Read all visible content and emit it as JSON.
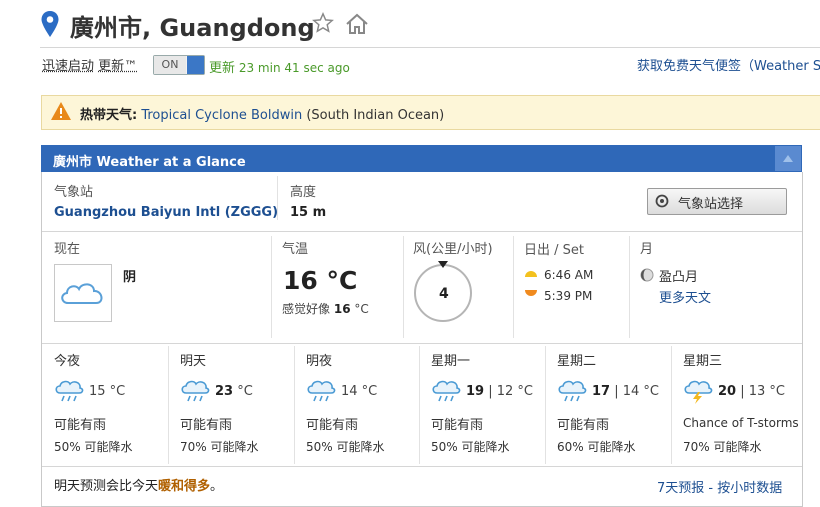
{
  "header": {
    "title": "廣州市, Guangdong"
  },
  "toolbar": {
    "quick_start": "迅速启动",
    "update": "更新™",
    "toggle_label": "ON",
    "updated_prefix": "更新",
    "updated_time": "23 min 41 sec ago",
    "widget_link": "获取免费天气便签（Weather S"
  },
  "alert": {
    "label": "热带天气:",
    "link": "Tropical Cyclone Boldwin",
    "region": "(South Indian Ocean)"
  },
  "glance": {
    "title": "廣州市 Weather at a Glance",
    "station_label": "气象站",
    "station_value": "Guangzhou Baiyun Intl (ZGGG)",
    "elevation_label": "高度",
    "elevation_value": "15 m",
    "station_button": "气象站选择",
    "now_label": "现在",
    "condition": "阴",
    "temp_label": "气温",
    "temp_value": "16 °C",
    "feels_label": "感觉好像",
    "feels_value": "16",
    "feels_unit": "°C",
    "wind_label": "风(公里/小时)",
    "wind_value": "4",
    "sun_label": "日出 / Set",
    "sunrise": "6:46 AM",
    "sunset": "5:39 PM",
    "moon_label": "月",
    "moon_phase": "盈凸月",
    "more_astro": "更多天文"
  },
  "forecast": [
    {
      "name": "今夜",
      "hi": "",
      "lo": "15 °C",
      "cond": "可能有雨",
      "pop": "50% 可能降水",
      "icon": "rain-cloud-icon"
    },
    {
      "name": "明天",
      "hi": "23",
      "lo": "°C",
      "cond": "可能有雨",
      "pop": "70% 可能降水",
      "icon": "rain-cloud-icon"
    },
    {
      "name": "明夜",
      "hi": "",
      "lo": "14 °C",
      "cond": "可能有雨",
      "pop": "50% 可能降水",
      "icon": "rain-cloud-icon"
    },
    {
      "name": "星期一",
      "hi": "19",
      "lo": "| 12 °C",
      "cond": "可能有雨",
      "pop": "50% 可能降水",
      "icon": "rain-cloud-icon"
    },
    {
      "name": "星期二",
      "hi": "17",
      "lo": "| 14 °C",
      "cond": "可能有雨",
      "pop": "60% 可能降水",
      "icon": "rain-cloud-icon"
    },
    {
      "name": "星期三",
      "hi": "20",
      "lo": "| 13 °C",
      "cond": "Chance of T-storms",
      "pop": "70% 可能降水",
      "icon": "thunderstorm-icon"
    }
  ],
  "footer": {
    "summary_prefix": "明天预测会比今天",
    "summary_highlight": "暖和得多",
    "summary_suffix": "。",
    "links": "7天预报 - 按小时数据"
  },
  "colors": {
    "header_blue": "#2f68b8",
    "link_blue": "#1d4f91",
    "alert_bg": "#fdf6d8",
    "updated_green": "#4a9a2a",
    "highlight_orange": "#b06000"
  }
}
